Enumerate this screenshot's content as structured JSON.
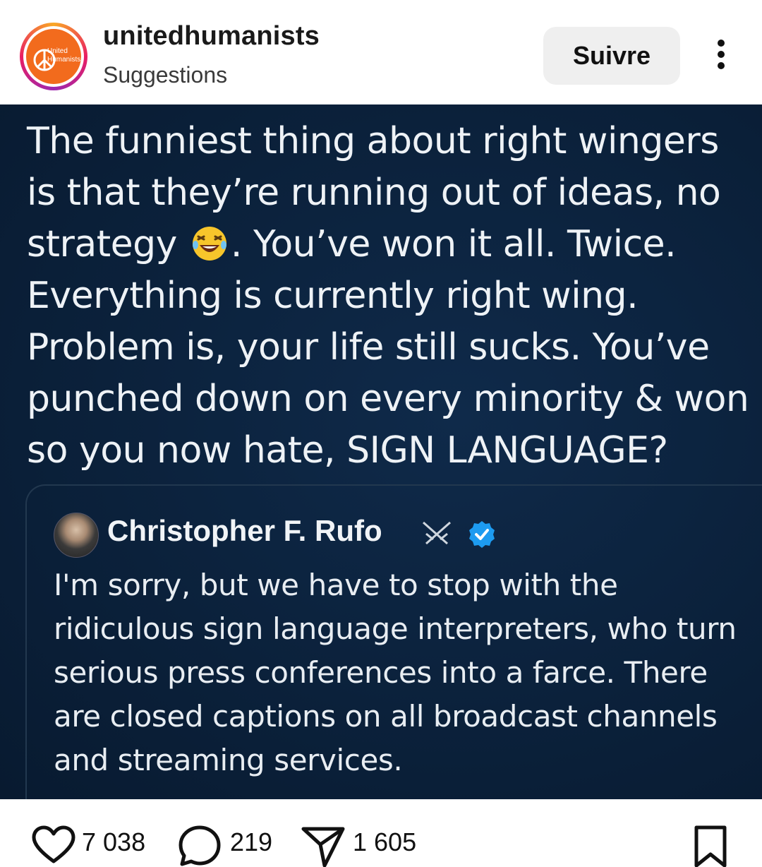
{
  "header": {
    "username": "unitedhumanists",
    "subtitle": "Suggestions",
    "follow_label": "Suivre",
    "avatar_text_line1": "United",
    "avatar_text_line2": "Humanists"
  },
  "post": {
    "main_text_part1": "The funniest thing about right wingers is that they’re running out of ideas, no strategy",
    "emoji": "rolling-on-floor-laughing",
    "main_text_part2": ". You’ve won it all. Twice. Everything is currently right wing. Problem is, your life still sucks. You’ve punched down on every minority & won so you now hate, SIGN LANGUAGE?",
    "quote": {
      "author": "Christopher F. Rufo",
      "text": "I'm sorry, but we have to stop with the ridiculous sign language interpreters, who turn serious press conferences into a farce. There are closed captions on all broadcast channels and streaming services."
    }
  },
  "actions": {
    "likes": "7 038",
    "comments": "219",
    "shares": "1 605"
  },
  "colors": {
    "post_background": "#0b213b",
    "avatar_orange": "#f26b1d",
    "verified_blue": "#1d9bf0"
  }
}
